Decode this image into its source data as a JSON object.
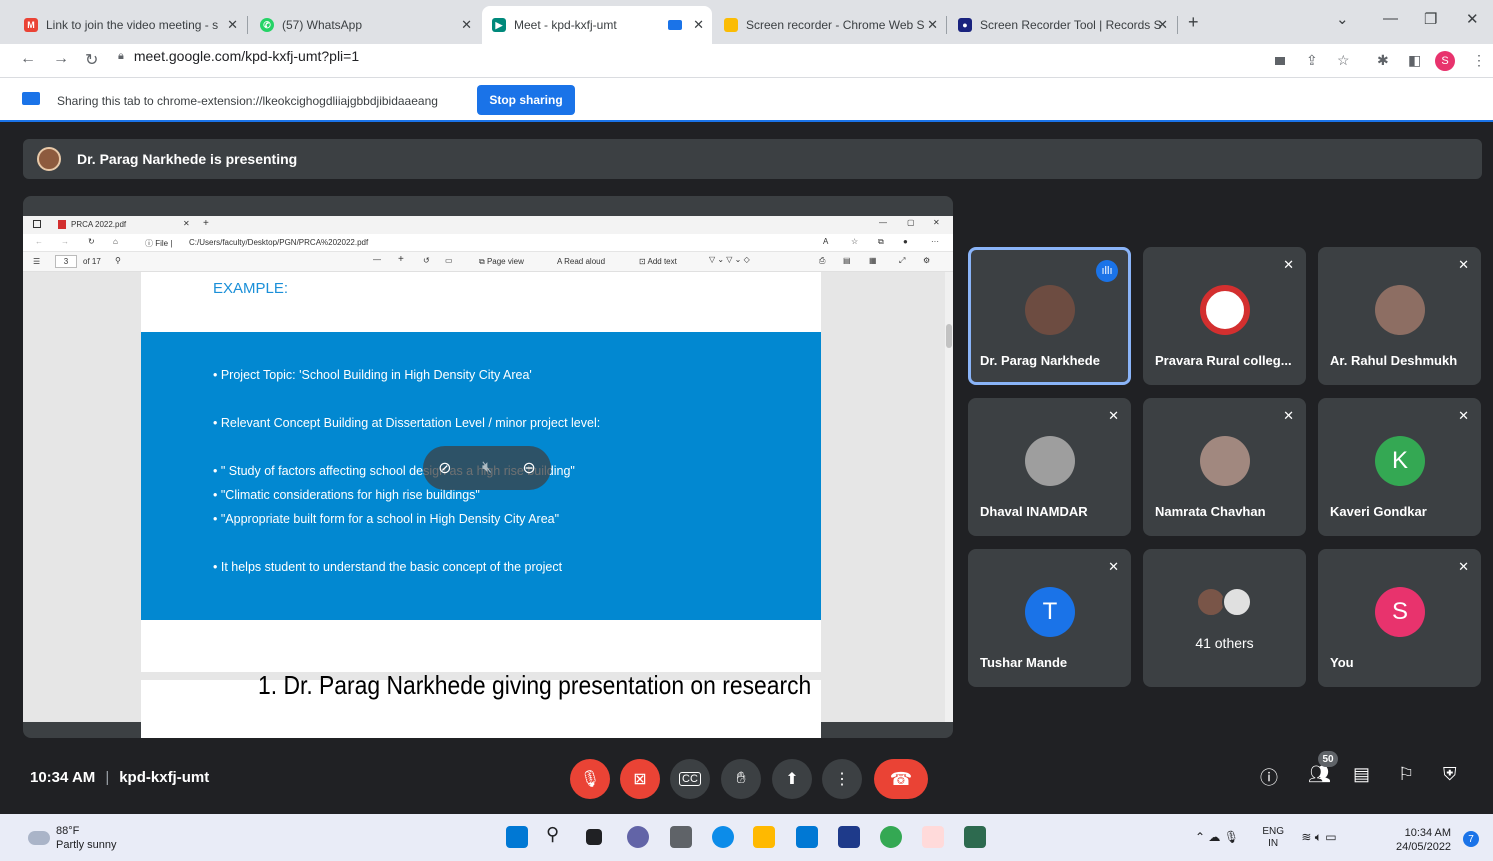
{
  "browser": {
    "tabs": [
      {
        "title": "Link to join the video meeting - s",
        "favicon": "gmail-icon",
        "color": "#ea4335"
      },
      {
        "title": "(57) WhatsApp",
        "favicon": "whatsapp-icon",
        "color": "#25d366"
      },
      {
        "title": "Meet - kpd-kxfj-umt",
        "favicon": "meet-icon",
        "color": "#00897b"
      },
      {
        "title": "Screen recorder - Chrome Web S",
        "favicon": "webstore-icon",
        "color": "#fbbc04"
      },
      {
        "title": "Screen Recorder Tool | Records S",
        "favicon": "recorder-icon",
        "color": "#1a237e"
      }
    ],
    "url": "meet.google.com/kpd-kxfj-umt?pli=1",
    "profile_initial": "S"
  },
  "sharebar": {
    "text": "Sharing this tab to chrome-extension://lkeokcighogdliiajgbbdjibidaaeang",
    "stop_label": "Stop sharing"
  },
  "meet": {
    "presenter_banner": "Dr. Parag Narkhede is presenting",
    "meeting_time": "10:34 AM",
    "meeting_code": "kpd-kxfj-umt",
    "participant_count": "50",
    "caption": "1. Dr. Parag Narkhede giving presentation on research",
    "participants": [
      {
        "name": "Dr. Parag Narkhede",
        "initial": "",
        "color": "#6d4c41",
        "speaking": true
      },
      {
        "name": "Pravara Rural colleg...",
        "initial": "",
        "color": "#d32f2f",
        "speaking": false
      },
      {
        "name": "Ar. Rahul Deshmukh",
        "initial": "",
        "color": "#8d6e63",
        "speaking": false
      },
      {
        "name": "Dhaval INAMDAR",
        "initial": "",
        "color": "#9e9e9e",
        "speaking": false
      },
      {
        "name": "Namrata Chavhan",
        "initial": "",
        "color": "#a1887f",
        "speaking": false
      },
      {
        "name": "Kaveri Gondkar",
        "initial": "K",
        "color": "#34a853",
        "speaking": false
      },
      {
        "name": "Tushar Mande",
        "initial": "T",
        "color": "#1a73e8",
        "speaking": false
      },
      {
        "name": "41 others",
        "initial": "",
        "color": "#795548",
        "speaking": false
      },
      {
        "name": "You",
        "initial": "S",
        "color": "#e8336d",
        "speaking": false
      }
    ]
  },
  "shared_screen": {
    "tab_title": "PRCA 2022.pdf",
    "file_path": "C:/Users/faculty/Desktop/PGN/PRCA%202022.pdf",
    "page_current": "3",
    "page_total": "of 17",
    "toolbar": {
      "page_view": "Page view",
      "read_aloud": "Read aloud",
      "add_text": "Add text"
    },
    "slide_title": "EXAMPLE:",
    "bullets": [
      "• Project Topic:  'School Building in High Density City Area'",
      "• Relevant Concept Building at Dissertation Level / minor project level:",
      "• \" Study of factors affecting school design as a high rise building\"",
      "• \"Climatic considerations for high rise buildings\"",
      "• \"Appropriate built form for a school in High Density City Area\"",
      "• It helps student to understand the basic concept of the project"
    ]
  },
  "taskbar": {
    "temperature": "88°F",
    "weather": "Partly sunny",
    "lang_top": "ENG",
    "lang_bottom": "IN",
    "time": "10:34 AM",
    "date": "24/05/2022",
    "notifications": "7"
  }
}
